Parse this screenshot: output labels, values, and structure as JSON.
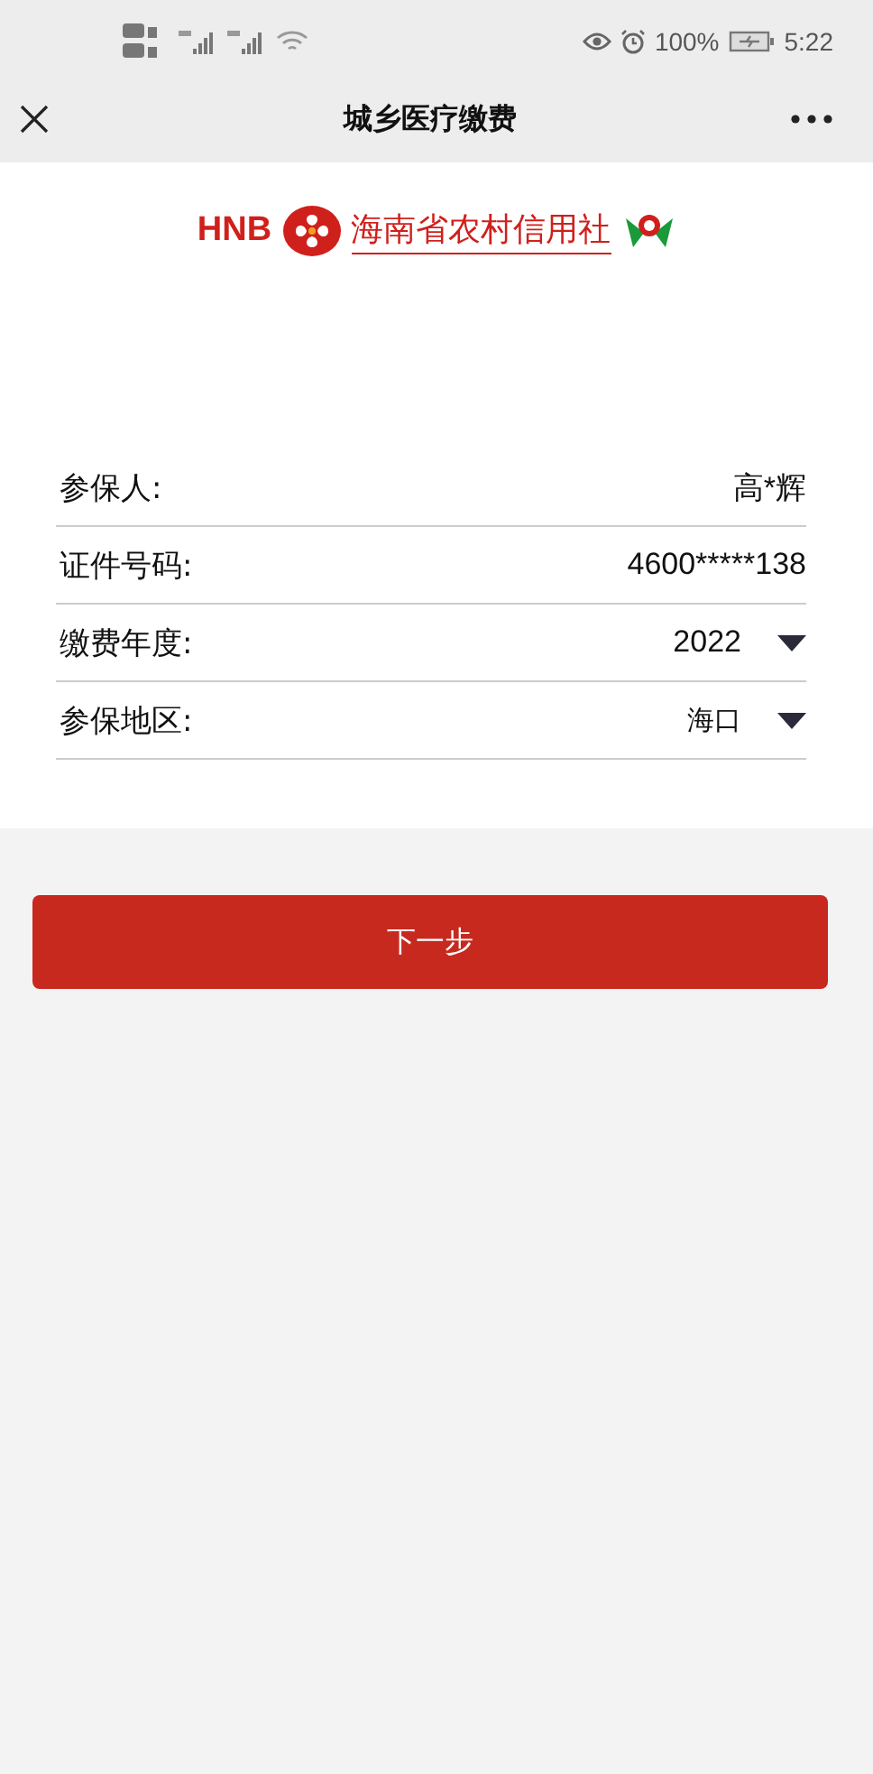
{
  "status_bar": {
    "battery": "100%",
    "time": "5:22"
  },
  "header": {
    "title": "城乡医疗缴费"
  },
  "logo": {
    "abbr": "HNB",
    "name": "海南省农村信用社"
  },
  "form": {
    "rows": [
      {
        "label": "参保人:",
        "value": "高*辉",
        "kind": "text"
      },
      {
        "label": "证件号码:",
        "value": "4600*****138",
        "kind": "text"
      },
      {
        "label": "缴费年度:",
        "value": "2022",
        "kind": "select"
      },
      {
        "label": "参保地区:",
        "value": "海口",
        "kind": "select",
        "small": true
      }
    ]
  },
  "next_button": {
    "label": "下一步"
  }
}
